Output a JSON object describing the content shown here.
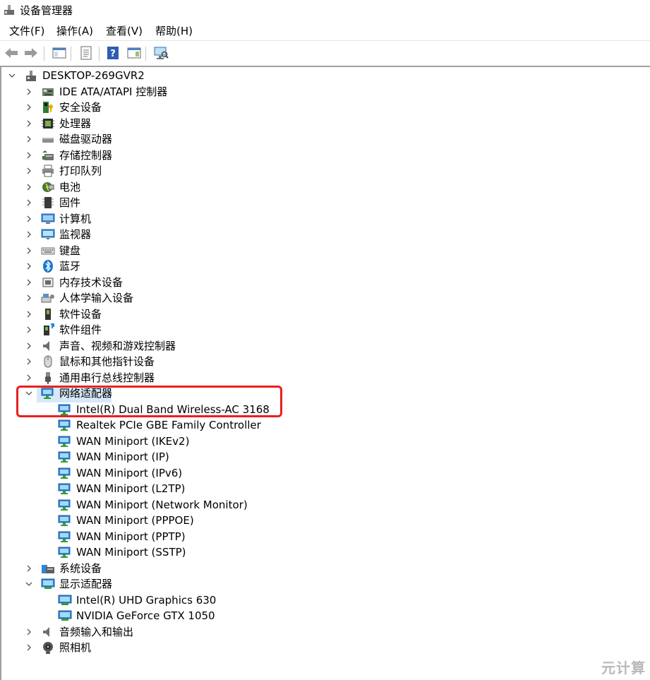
{
  "window": {
    "title": "设备管理器"
  },
  "menu": [
    "文件(F)",
    "操作(A)",
    "查看(V)",
    "帮助(H)"
  ],
  "tree": {
    "root": "DESKTOP-269GVR2",
    "categories": [
      {
        "label": "IDE ATA/ATAPI 控制器",
        "icon": "ide-controller-icon",
        "expanded": false
      },
      {
        "label": "安全设备",
        "icon": "security-device-icon",
        "expanded": false
      },
      {
        "label": "处理器",
        "icon": "processor-icon",
        "expanded": false
      },
      {
        "label": "磁盘驱动器",
        "icon": "disk-drive-icon",
        "expanded": false
      },
      {
        "label": "存储控制器",
        "icon": "storage-controller-icon",
        "expanded": false
      },
      {
        "label": "打印队列",
        "icon": "printer-icon",
        "expanded": false
      },
      {
        "label": "电池",
        "icon": "battery-icon",
        "expanded": false
      },
      {
        "label": "固件",
        "icon": "firmware-icon",
        "expanded": false
      },
      {
        "label": "计算机",
        "icon": "computer-icon",
        "expanded": false
      },
      {
        "label": "监视器",
        "icon": "monitor-icon",
        "expanded": false
      },
      {
        "label": "键盘",
        "icon": "keyboard-icon",
        "expanded": false
      },
      {
        "label": "蓝牙",
        "icon": "bluetooth-icon",
        "expanded": false
      },
      {
        "label": "内存技术设备",
        "icon": "memory-device-icon",
        "expanded": false
      },
      {
        "label": "人体学输入设备",
        "icon": "hid-icon",
        "expanded": false
      },
      {
        "label": "软件设备",
        "icon": "software-device-icon",
        "expanded": false
      },
      {
        "label": "软件组件",
        "icon": "software-component-icon",
        "expanded": false
      },
      {
        "label": "声音、视频和游戏控制器",
        "icon": "sound-icon",
        "expanded": false
      },
      {
        "label": "鼠标和其他指针设备",
        "icon": "mouse-icon",
        "expanded": false
      },
      {
        "label": "通用串行总线控制器",
        "icon": "usb-icon",
        "expanded": false
      },
      {
        "label": "网络适配器",
        "icon": "network-adapter-icon",
        "expanded": true,
        "selected": true,
        "children": [
          "Intel(R) Dual Band Wireless-AC 3168",
          "Realtek PCIe GBE Family Controller",
          "WAN Miniport (IKEv2)",
          "WAN Miniport (IP)",
          "WAN Miniport (IPv6)",
          "WAN Miniport (L2TP)",
          "WAN Miniport (Network Monitor)",
          "WAN Miniport (PPPOE)",
          "WAN Miniport (PPTP)",
          "WAN Miniport (SSTP)"
        ]
      },
      {
        "label": "系统设备",
        "icon": "system-device-icon",
        "expanded": false
      },
      {
        "label": "显示适配器",
        "icon": "display-adapter-icon",
        "expanded": true,
        "children": [
          "Intel(R) UHD Graphics 630",
          "NVIDIA GeForce GTX 1050"
        ]
      },
      {
        "label": "音频输入和输出",
        "icon": "audio-io-icon",
        "expanded": false
      },
      {
        "label": "照相机",
        "icon": "camera-icon",
        "expanded": false
      }
    ]
  },
  "watermark": "元计算",
  "colors": {
    "highlight": "#e8201f",
    "selection": "#d7e9f8"
  }
}
